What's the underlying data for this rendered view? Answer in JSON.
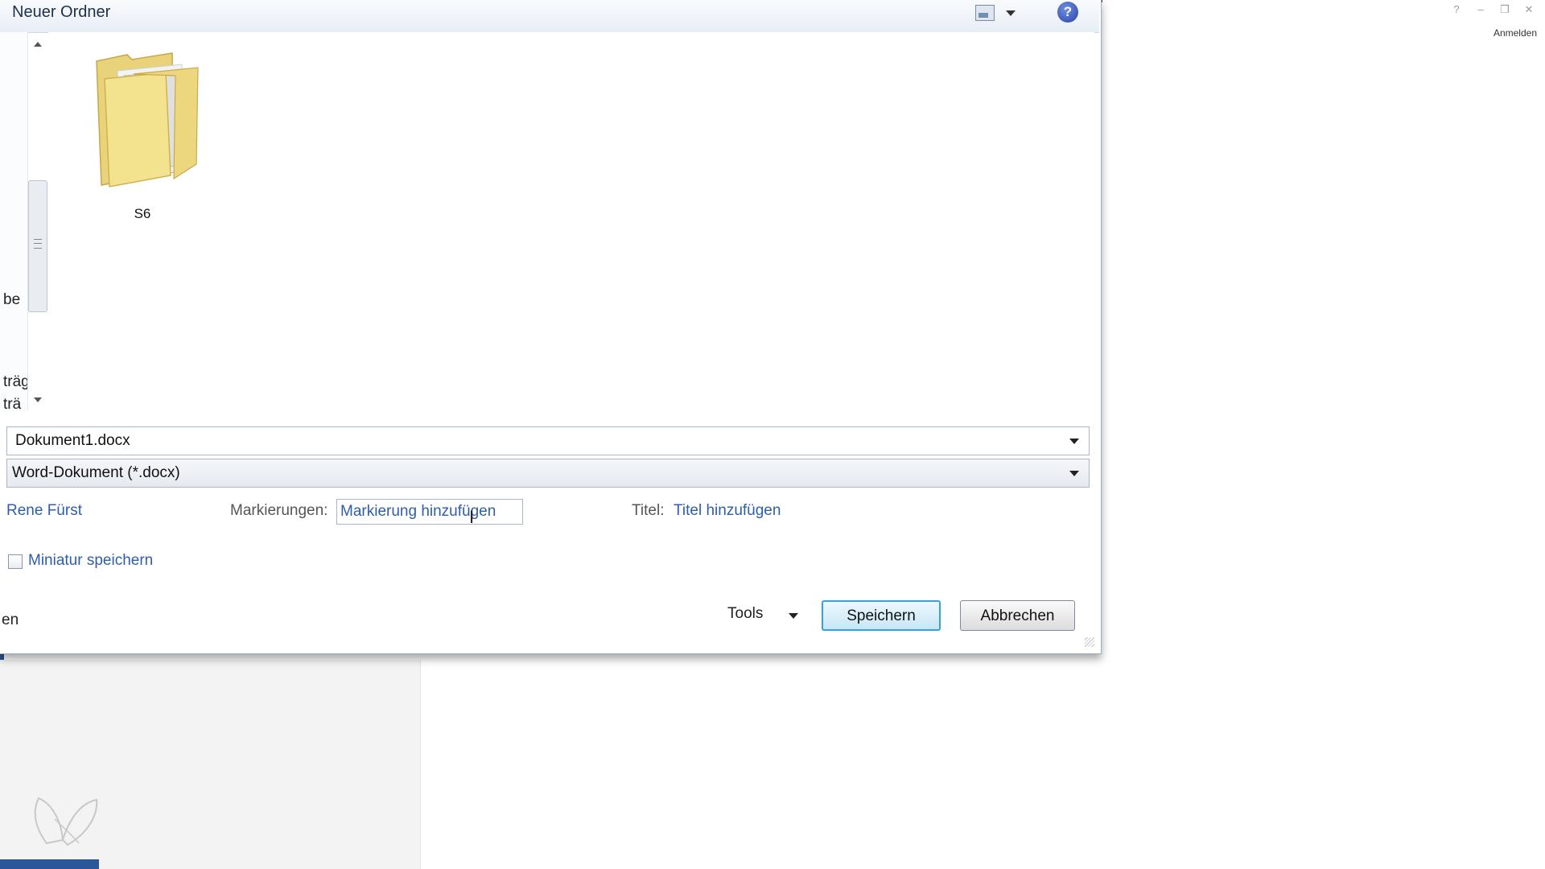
{
  "dialog": {
    "current_folder": "Neuer Ordner",
    "nav_fragments": [
      "be",
      "träg",
      "trä"
    ],
    "folder": {
      "name": "S6"
    },
    "filename": {
      "value": "Dokument1.docx"
    },
    "filetype": {
      "value": "Word-Dokument (*.docx)"
    },
    "author": "Rene Fürst",
    "tags": {
      "label": "Markierungen:",
      "value": "Markierung hinzufügen"
    },
    "title": {
      "label": "Titel:",
      "value": "Titel hinzufügen"
    },
    "thumbnail": {
      "label": "Miniatur speichern",
      "checked": false
    },
    "left_fragment": "en",
    "tools_label": "Tools",
    "save_label": "Speichern",
    "cancel_label": "Abbrechen"
  },
  "window": {
    "sign_in": "Anmelden",
    "controls": [
      "?",
      "–",
      "❐",
      "✕"
    ]
  },
  "colors": {
    "accent": "#2b579a",
    "link": "#2f5ea8",
    "save_border": "#3aa0d8"
  }
}
